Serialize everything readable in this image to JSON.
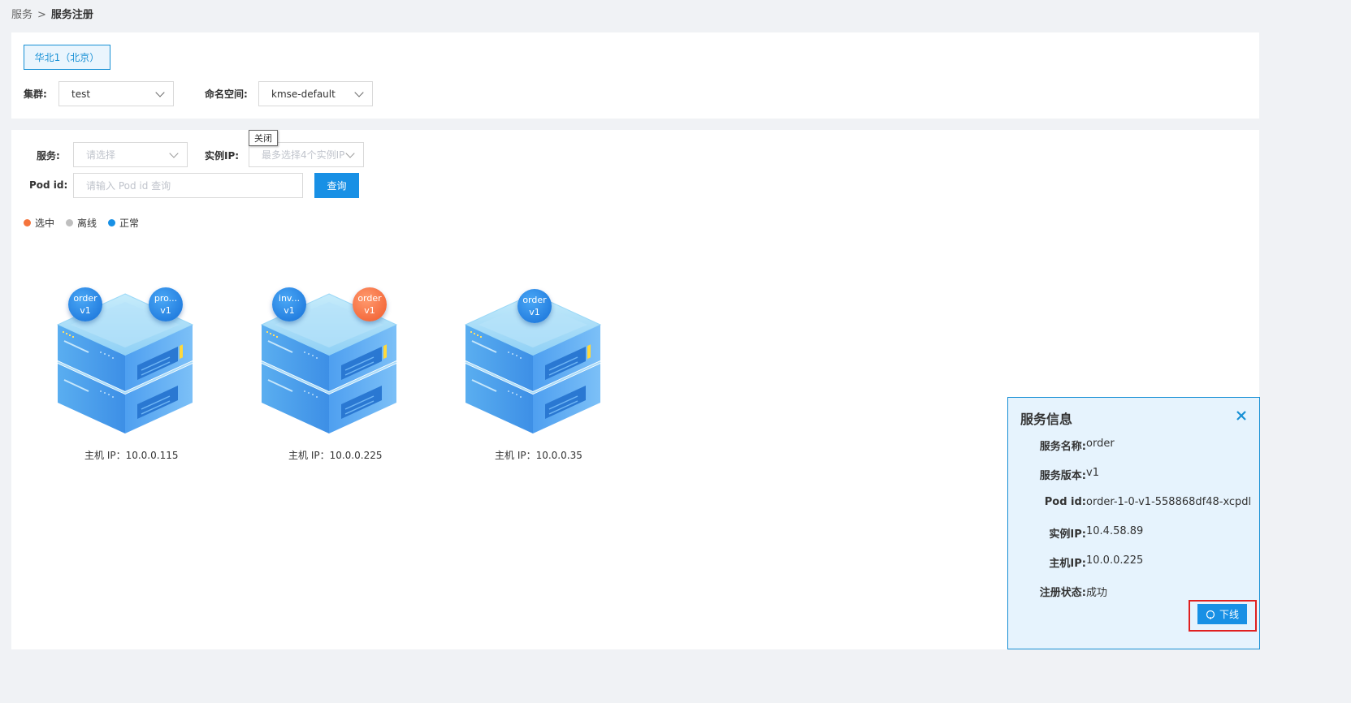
{
  "breadcrumb": {
    "parent": "服务",
    "separator": ">",
    "current": "服务注册"
  },
  "region_tab": "华北1（北京）",
  "filters": {
    "cluster_label": "集群:",
    "cluster_value": "test",
    "namespace_label": "命名空间:",
    "namespace_value": "kmse-default"
  },
  "search": {
    "service_label": "服务:",
    "service_placeholder": "请选择",
    "instance_ip_label": "实例IP:",
    "instance_ip_placeholder": "最多选择4个实例IP",
    "pod_id_label": "Pod id:",
    "pod_id_placeholder": "请输入 Pod id 查询",
    "query_button": "查询"
  },
  "legend": [
    {
      "label": "选中",
      "color": "#f5743c"
    },
    {
      "label": "离线",
      "color": "#bfbfbf"
    },
    {
      "label": "正常",
      "color": "#1890e5"
    }
  ],
  "hosts": [
    {
      "ip_label": "主机 IP：10.0.0.115",
      "pods": [
        {
          "name": "order",
          "version": "v1",
          "state": "normal"
        },
        {
          "name": "pro...",
          "version": "v1",
          "state": "normal"
        }
      ]
    },
    {
      "ip_label": "主机 IP：10.0.0.225",
      "pods": [
        {
          "name": "inv...",
          "version": "v1",
          "state": "normal"
        },
        {
          "name": "order",
          "version": "v1",
          "state": "selected"
        }
      ]
    },
    {
      "ip_label": "主机 IP：10.0.0.35",
      "pods": [
        {
          "name": "order",
          "version": "v1",
          "state": "normal"
        }
      ]
    }
  ],
  "close_tooltip": "关闭",
  "service_info": {
    "title": "服务信息",
    "rows": [
      {
        "key": "服务名称:",
        "value": "order"
      },
      {
        "key": "服务版本:",
        "value": "v1"
      },
      {
        "key": "Pod id:",
        "value": "order-1-0-v1-558868df48-xcpdl"
      },
      {
        "key": "实例IP:",
        "value": "10.4.58.89"
      },
      {
        "key": "主机IP:",
        "value": "10.0.0.225"
      },
      {
        "key": "注册状态:",
        "value": "成功"
      }
    ],
    "offline_button": "下线"
  },
  "colors": {
    "accent": "#1890e5",
    "selected": "#f5743c",
    "offline": "#bfbfbf",
    "highlight": "#e02020"
  }
}
